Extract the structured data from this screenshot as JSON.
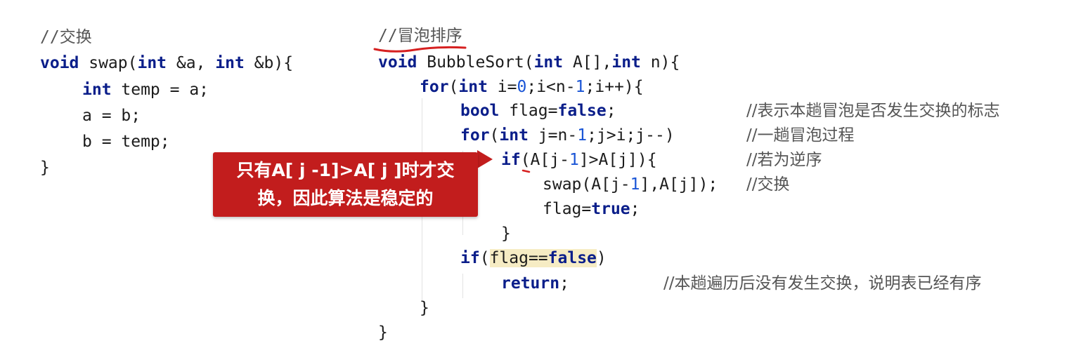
{
  "left_code": {
    "comment": "//交换",
    "sig": {
      "kw": "void",
      "rest1": " swap(",
      "kw2": "int",
      "rest2": " &a, ",
      "kw3": "int",
      "rest3": " &b){"
    },
    "l2": {
      "kw": "int",
      "rest": " temp = a;"
    },
    "l3": "a = b;",
    "l4": "b = temp;",
    "l5": "}"
  },
  "right_code": {
    "comment_slash": "//",
    "comment_text": "冒泡排序",
    "sig": {
      "kw": "void",
      "r1": " BubbleSort(",
      "kw2": "int",
      "r2": " A[],",
      "kw3": "int",
      "r3": " n){"
    },
    "for1": {
      "kw": "for",
      "r1": "(",
      "kw2": "int",
      "r2": " i=",
      "n1": "0",
      "r3": ";i<n-",
      "n2": "1",
      "r4": ";i++){"
    },
    "flag": {
      "kw": "bool",
      "r1": " flag=",
      "kw2": "false",
      "r2": ";",
      "comment": "//表示本趟冒泡是否发生交换的标志"
    },
    "for2": {
      "kw": "for",
      "r1": "(",
      "kw2": "int",
      "r2": " j=n-",
      "n1": "1",
      "r3": ";j>i;j--)",
      "comment": "//一趟冒泡过程"
    },
    "if1": {
      "kw": "if",
      "r1": "(A[j-",
      "n1": "1",
      "r2": "]>A[j]){",
      "comment": "//若为逆序"
    },
    "swap": {
      "r1": "swap(A[j-",
      "n1": "1",
      "r2": "],A[j]);",
      "comment": "//交换"
    },
    "flagtrue": {
      "r1": "flag=",
      "kw": "true",
      "r2": ";"
    },
    "close1": "}",
    "if2": {
      "kw": "if",
      "r1": "(",
      "hl1": "flag==",
      "hl_kw": "false",
      "r2": ")"
    },
    "ret": {
      "kw": "return",
      "r1": ";",
      "comment": "//本趟遍历后没有发生交换，说明表已经有序"
    },
    "close2": "}",
    "close3": "}"
  },
  "callout": {
    "line1": "只有A[ j -1]>A[ j ]时才交",
    "line2": "换，因此算法是稳定的"
  },
  "colors": {
    "keyword": "#0a1e8a",
    "number": "#1a55d6",
    "callout_bg": "#c21d1d",
    "annotation": "#d62020",
    "highlight": "#f6ecc4"
  }
}
